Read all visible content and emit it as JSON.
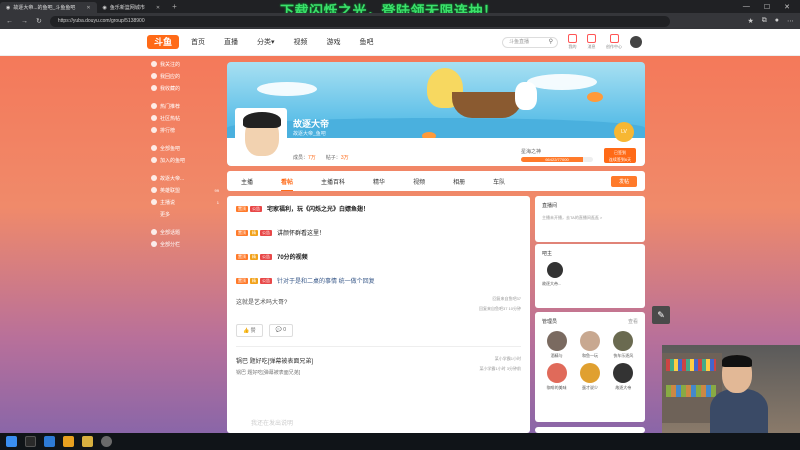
{
  "browser": {
    "tabs": [
      {
        "label": "故逐大帝...的鱼吧_斗鱼鱼吧",
        "active": true
      },
      {
        "label": "鱼乐新篮网城市",
        "active": false
      }
    ],
    "url": "https://yuba.douyu.com/group/5138900",
    "new_tab": "+"
  },
  "overlay_banner": "下载闪烁之光，登陆领无限连抽！",
  "site": {
    "logo": "斗鱼",
    "nav": [
      "首页",
      "直播",
      "分类▾",
      "视频",
      "游戏",
      "鱼吧"
    ],
    "search_placeholder": "斗鱼直播",
    "nav_icons": [
      "我的",
      "消息",
      "创作中心"
    ]
  },
  "sidebar": {
    "groups": [
      [
        {
          "label": "我关注的",
          "icon": "star-icon"
        },
        {
          "label": "我回应的",
          "icon": "reply-icon"
        },
        {
          "label": "我收藏的",
          "icon": "bookmark-icon"
        }
      ],
      [
        {
          "label": "热门推荐",
          "icon": "fire-icon"
        },
        {
          "label": "社区热帖",
          "icon": "chat-icon"
        },
        {
          "label": "排行榜",
          "icon": "trophy-icon"
        }
      ],
      [
        {
          "label": "全部鱼吧",
          "icon": "grid-icon"
        },
        {
          "label": "加入的鱼吧",
          "icon": "plus-icon"
        }
      ],
      [
        {
          "label": "故逐大帝...",
          "icon": "avatar-icon"
        },
        {
          "label": "英雄联盟",
          "icon": "game-icon",
          "count": "99"
        },
        {
          "label": "主播说",
          "icon": "mic-icon",
          "count": "1"
        },
        {
          "label": "更多",
          "icon": "",
          "count": ""
        }
      ],
      [
        {
          "label": "全部话题",
          "icon": "topic-icon"
        },
        {
          "label": "全部分栏",
          "icon": "column-icon"
        }
      ]
    ]
  },
  "group": {
    "name": "故逐大帝",
    "desc": "故逐大帝_鱼吧",
    "members_label": "成员：",
    "members": "7万",
    "posts_label": "帖子：",
    "posts": "3万",
    "level_label": "星海之神",
    "level_progress": "66422/77000",
    "level_fraction": 0.86,
    "checkin_line1": "已签到",
    "checkin_line2": "连续签到6天",
    "medal": "LV"
  },
  "tabs": {
    "items": [
      "主播",
      "看帖",
      "主播百科",
      "精华",
      "视频",
      "相册",
      "车队"
    ],
    "active_index": 1,
    "post_button": "发帖"
  },
  "posts": [
    {
      "tags": [
        "置顶",
        "公告"
      ],
      "title": "宅家福利，玩《闪烁之光》白嫖鱼翅！",
      "style": "bold"
    },
    {
      "tags": [
        "置顶",
        "精",
        "公告"
      ],
      "title": "讲颜怀群看这里！",
      "style": "normal"
    },
    {
      "tags": [
        "置顶",
        "精",
        "公告"
      ],
      "title": "70分的视频",
      "style": "bold"
    },
    {
      "tags": [
        "置顶",
        "精",
        "公告"
      ],
      "title": "针对于是和二桌的事情 统一做个回复",
      "style": "blue"
    }
  ],
  "plain_post": {
    "title": "这就是艺术吗大哥?",
    "meta1": "回复来自鱼吧37",
    "meta2": "回复来自鱼吧37  10分钟"
  },
  "actions": {
    "like": "赞",
    "comment": "0"
  },
  "author_post": {
    "title": "锅巴 题好吃[弹幕被表面兄弟]",
    "sub": "锅巴 题好吃[弹幕被表面兄弟]",
    "meta1": "某小学霸1小时",
    "meta2": "某小学霸1小时  3分钟前"
  },
  "faded_text": "我还在发出说明",
  "right": {
    "live": {
      "title": "直播间",
      "body": "主播未开播，去TA的直播间逛逛 >"
    },
    "owner": {
      "title": "吧主",
      "name": "故逐大帝..."
    },
    "admins": {
      "title": "管理员",
      "more": "查看",
      "list": [
        {
          "name": "酒精与",
          "color": "#7a6a60"
        },
        {
          "name": "和鱼一玩",
          "color": "#c8a890"
        },
        {
          "name": "快车乐逐风",
          "color": "#6a6a50"
        },
        {
          "name": "咖啡的美味",
          "color": "#e06a5a"
        },
        {
          "name": "蛋才说少",
          "color": "#e0a030"
        },
        {
          "name": "故逐大帝",
          "color": "#333333"
        }
      ]
    }
  },
  "colors": {
    "accent": "#ff6a17",
    "overlay_green": "#3ce06a"
  }
}
